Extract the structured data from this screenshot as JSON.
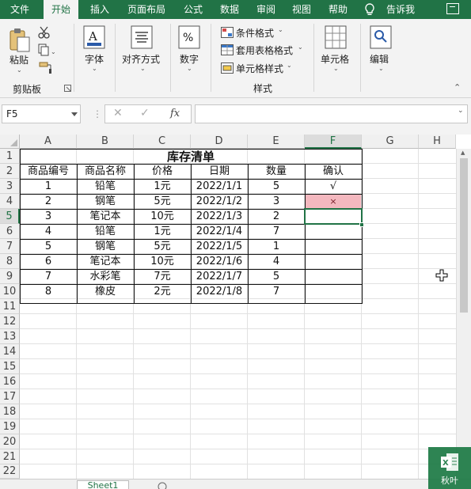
{
  "ribbon": {
    "tabs": [
      {
        "label": "文件",
        "active": false
      },
      {
        "label": "开始",
        "active": true
      },
      {
        "label": "插入",
        "active": false
      },
      {
        "label": "页面布局",
        "active": false
      },
      {
        "label": "公式",
        "active": false
      },
      {
        "label": "数据",
        "active": false
      },
      {
        "label": "审阅",
        "active": false
      },
      {
        "label": "视图",
        "active": false
      },
      {
        "label": "帮助",
        "active": false
      }
    ],
    "tell_me": "告诉我",
    "clipboard": {
      "paste": "粘贴",
      "group": "剪贴板"
    },
    "font": "字体",
    "alignment": "对齐方式",
    "number": "数字",
    "styles": {
      "conditional": "条件格式",
      "table_format": "套用表格格式",
      "cell_styles": "单元格样式",
      "group": "样式"
    },
    "cells": "单元格",
    "editing": "编辑"
  },
  "formula_bar": {
    "name_box": "F5",
    "fx": "fx",
    "formula": ""
  },
  "grid": {
    "columns": [
      "A",
      "B",
      "C",
      "D",
      "E",
      "F",
      "G",
      "H"
    ],
    "rows": [
      "1",
      "2",
      "3",
      "4",
      "5",
      "6",
      "7",
      "8",
      "9",
      "10",
      "11",
      "12",
      "13",
      "14",
      "15",
      "16",
      "17",
      "18",
      "19",
      "20",
      "21",
      "22"
    ],
    "selected_cell": "F5"
  },
  "table": {
    "title": "库存清单",
    "headers": [
      "商品编号",
      "商品名称",
      "价格",
      "日期",
      "数量",
      "确认"
    ],
    "rows": [
      [
        "1",
        "铅笔",
        "1元",
        "2022/1/1",
        "5",
        "√"
      ],
      [
        "2",
        "钢笔",
        "5元",
        "2022/1/2",
        "3",
        "×"
      ],
      [
        "3",
        "笔记本",
        "10元",
        "2022/1/3",
        "2",
        ""
      ],
      [
        "4",
        "铅笔",
        "1元",
        "2022/1/4",
        "7",
        ""
      ],
      [
        "5",
        "钢笔",
        "5元",
        "2022/1/5",
        "1",
        ""
      ],
      [
        "6",
        "笔记本",
        "10元",
        "2022/1/6",
        "4",
        ""
      ],
      [
        "7",
        "水彩笔",
        "7元",
        "2022/1/7",
        "5",
        ""
      ],
      [
        "8",
        "橡皮",
        "2元",
        "2022/1/8",
        "7",
        ""
      ]
    ],
    "highlight_color": "#f4b8bf"
  },
  "sheet_tab": "Sheet1",
  "watermark": "秋叶",
  "colors": {
    "accent": "#217346"
  }
}
